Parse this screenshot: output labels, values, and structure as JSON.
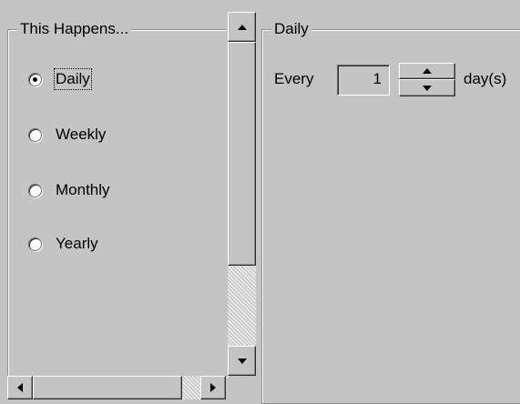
{
  "frequency_group": {
    "legend": "This Happens...",
    "options": [
      {
        "label": "Daily",
        "checked": true
      },
      {
        "label": "Weekly",
        "checked": false
      },
      {
        "label": "Monthly",
        "checked": false
      },
      {
        "label": "Yearly",
        "checked": false
      }
    ]
  },
  "daily_group": {
    "legend": "Daily",
    "every_label": "Every",
    "interval_value": "1",
    "unit_label": "day(s)"
  },
  "icons": {
    "scroll_up": "triangle-up",
    "scroll_down": "triangle-down",
    "scroll_left": "triangle-left",
    "scroll_right": "triangle-right",
    "spin_up": "triangle-up",
    "spin_down": "triangle-down"
  }
}
